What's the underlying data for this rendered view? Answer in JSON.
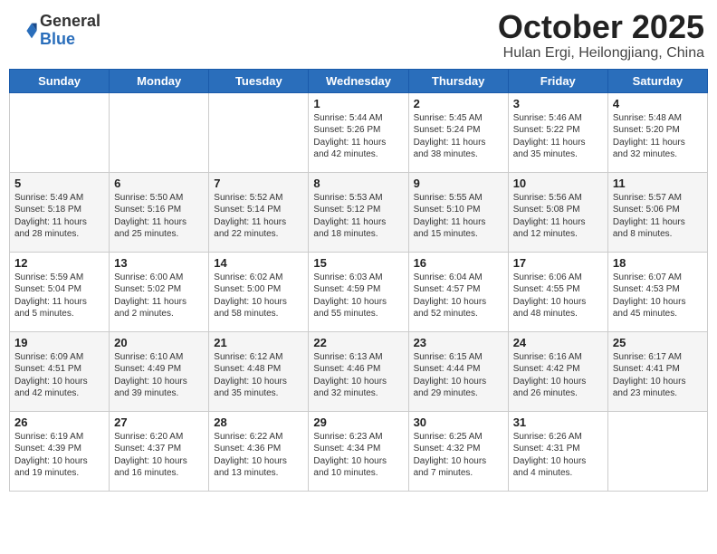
{
  "header": {
    "logo_general": "General",
    "logo_blue": "Blue",
    "month": "October 2025",
    "location": "Hulan Ergi, Heilongjiang, China"
  },
  "days_of_week": [
    "Sunday",
    "Monday",
    "Tuesday",
    "Wednesday",
    "Thursday",
    "Friday",
    "Saturday"
  ],
  "weeks": [
    [
      {
        "day": "",
        "info": ""
      },
      {
        "day": "",
        "info": ""
      },
      {
        "day": "",
        "info": ""
      },
      {
        "day": "1",
        "info": "Sunrise: 5:44 AM\nSunset: 5:26 PM\nDaylight: 11 hours\nand 42 minutes."
      },
      {
        "day": "2",
        "info": "Sunrise: 5:45 AM\nSunset: 5:24 PM\nDaylight: 11 hours\nand 38 minutes."
      },
      {
        "day": "3",
        "info": "Sunrise: 5:46 AM\nSunset: 5:22 PM\nDaylight: 11 hours\nand 35 minutes."
      },
      {
        "day": "4",
        "info": "Sunrise: 5:48 AM\nSunset: 5:20 PM\nDaylight: 11 hours\nand 32 minutes."
      }
    ],
    [
      {
        "day": "5",
        "info": "Sunrise: 5:49 AM\nSunset: 5:18 PM\nDaylight: 11 hours\nand 28 minutes."
      },
      {
        "day": "6",
        "info": "Sunrise: 5:50 AM\nSunset: 5:16 PM\nDaylight: 11 hours\nand 25 minutes."
      },
      {
        "day": "7",
        "info": "Sunrise: 5:52 AM\nSunset: 5:14 PM\nDaylight: 11 hours\nand 22 minutes."
      },
      {
        "day": "8",
        "info": "Sunrise: 5:53 AM\nSunset: 5:12 PM\nDaylight: 11 hours\nand 18 minutes."
      },
      {
        "day": "9",
        "info": "Sunrise: 5:55 AM\nSunset: 5:10 PM\nDaylight: 11 hours\nand 15 minutes."
      },
      {
        "day": "10",
        "info": "Sunrise: 5:56 AM\nSunset: 5:08 PM\nDaylight: 11 hours\nand 12 minutes."
      },
      {
        "day": "11",
        "info": "Sunrise: 5:57 AM\nSunset: 5:06 PM\nDaylight: 11 hours\nand 8 minutes."
      }
    ],
    [
      {
        "day": "12",
        "info": "Sunrise: 5:59 AM\nSunset: 5:04 PM\nDaylight: 11 hours\nand 5 minutes."
      },
      {
        "day": "13",
        "info": "Sunrise: 6:00 AM\nSunset: 5:02 PM\nDaylight: 11 hours\nand 2 minutes."
      },
      {
        "day": "14",
        "info": "Sunrise: 6:02 AM\nSunset: 5:00 PM\nDaylight: 10 hours\nand 58 minutes."
      },
      {
        "day": "15",
        "info": "Sunrise: 6:03 AM\nSunset: 4:59 PM\nDaylight: 10 hours\nand 55 minutes."
      },
      {
        "day": "16",
        "info": "Sunrise: 6:04 AM\nSunset: 4:57 PM\nDaylight: 10 hours\nand 52 minutes."
      },
      {
        "day": "17",
        "info": "Sunrise: 6:06 AM\nSunset: 4:55 PM\nDaylight: 10 hours\nand 48 minutes."
      },
      {
        "day": "18",
        "info": "Sunrise: 6:07 AM\nSunset: 4:53 PM\nDaylight: 10 hours\nand 45 minutes."
      }
    ],
    [
      {
        "day": "19",
        "info": "Sunrise: 6:09 AM\nSunset: 4:51 PM\nDaylight: 10 hours\nand 42 minutes."
      },
      {
        "day": "20",
        "info": "Sunrise: 6:10 AM\nSunset: 4:49 PM\nDaylight: 10 hours\nand 39 minutes."
      },
      {
        "day": "21",
        "info": "Sunrise: 6:12 AM\nSunset: 4:48 PM\nDaylight: 10 hours\nand 35 minutes."
      },
      {
        "day": "22",
        "info": "Sunrise: 6:13 AM\nSunset: 4:46 PM\nDaylight: 10 hours\nand 32 minutes."
      },
      {
        "day": "23",
        "info": "Sunrise: 6:15 AM\nSunset: 4:44 PM\nDaylight: 10 hours\nand 29 minutes."
      },
      {
        "day": "24",
        "info": "Sunrise: 6:16 AM\nSunset: 4:42 PM\nDaylight: 10 hours\nand 26 minutes."
      },
      {
        "day": "25",
        "info": "Sunrise: 6:17 AM\nSunset: 4:41 PM\nDaylight: 10 hours\nand 23 minutes."
      }
    ],
    [
      {
        "day": "26",
        "info": "Sunrise: 6:19 AM\nSunset: 4:39 PM\nDaylight: 10 hours\nand 19 minutes."
      },
      {
        "day": "27",
        "info": "Sunrise: 6:20 AM\nSunset: 4:37 PM\nDaylight: 10 hours\nand 16 minutes."
      },
      {
        "day": "28",
        "info": "Sunrise: 6:22 AM\nSunset: 4:36 PM\nDaylight: 10 hours\nand 13 minutes."
      },
      {
        "day": "29",
        "info": "Sunrise: 6:23 AM\nSunset: 4:34 PM\nDaylight: 10 hours\nand 10 minutes."
      },
      {
        "day": "30",
        "info": "Sunrise: 6:25 AM\nSunset: 4:32 PM\nDaylight: 10 hours\nand 7 minutes."
      },
      {
        "day": "31",
        "info": "Sunrise: 6:26 AM\nSunset: 4:31 PM\nDaylight: 10 hours\nand 4 minutes."
      },
      {
        "day": "",
        "info": ""
      }
    ]
  ]
}
